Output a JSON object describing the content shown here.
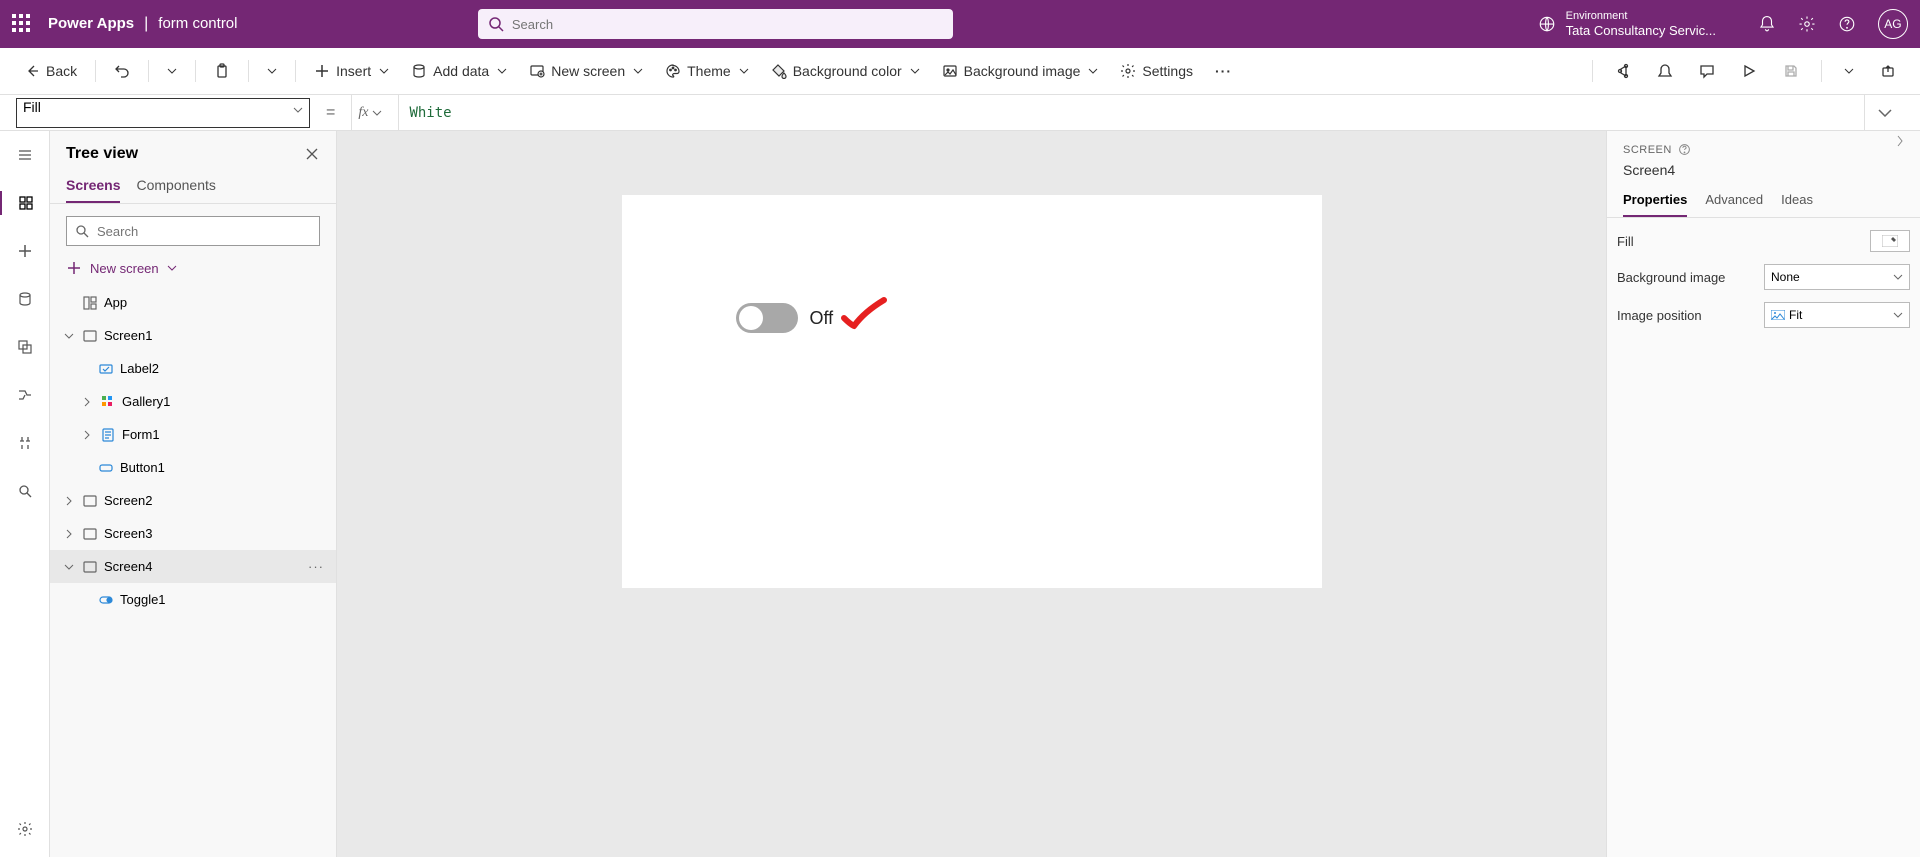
{
  "header": {
    "app_name": "Power Apps",
    "separator": "|",
    "file_name": "form control",
    "search_placeholder": "Search",
    "environment_label": "Environment",
    "environment_value": "Tata Consultancy Servic...",
    "avatar_initials": "AG"
  },
  "toolbar": {
    "back": "Back",
    "insert": "Insert",
    "add_data": "Add data",
    "new_screen": "New screen",
    "theme": "Theme",
    "background_color": "Background color",
    "background_image": "Background image",
    "settings": "Settings"
  },
  "formula": {
    "property": "Fill",
    "value": "White"
  },
  "treeview": {
    "title": "Tree view",
    "tab_screens": "Screens",
    "tab_components": "Components",
    "search_placeholder": "Search",
    "new_screen": "New screen",
    "items": {
      "app": "App",
      "screen1": "Screen1",
      "label2": "Label2",
      "gallery1": "Gallery1",
      "form1": "Form1",
      "button1": "Button1",
      "screen2": "Screen2",
      "screen3": "Screen3",
      "screen4": "Screen4",
      "toggle1": "Toggle1"
    }
  },
  "canvas": {
    "toggle_text": "Off"
  },
  "properties": {
    "context": "SCREEN",
    "screen_name": "Screen4",
    "tab_properties": "Properties",
    "tab_advanced": "Advanced",
    "tab_ideas": "Ideas",
    "fill_label": "Fill",
    "bg_image_label": "Background image",
    "bg_image_value": "None",
    "img_pos_label": "Image position",
    "img_pos_value": "Fit"
  }
}
